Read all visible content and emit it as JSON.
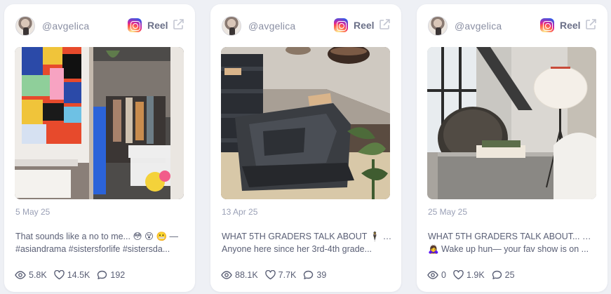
{
  "cards": [
    {
      "username": "@avgelica",
      "type": "Reel",
      "date": "5 May 25",
      "caption_line1": "That sounds like a no to me... 😳 😵 😬 —",
      "caption_line2": "#asiandrama #sistersforlife #sistersda...",
      "views": "5.8K",
      "likes": "14.5K",
      "comments": "192"
    },
    {
      "username": "@avgelica",
      "type": "Reel",
      "date": "13 Apr 25",
      "caption_line1": "WHAT 5TH GRADERS TALK ABOUT 🕴️ ☠️ 🙇‍♀️",
      "caption_line2": "Anyone here since her 3rd-4th grade...",
      "views": "88.1K",
      "likes": "7.7K",
      "comments": "39"
    },
    {
      "username": "@avgelica",
      "type": "Reel",
      "date": "25 May 25",
      "caption_line1": "WHAT 5TH GRADERS TALK ABOUT... 😳 💀",
      "caption_line2": "🙇‍♀️ Wake up hun— your fav show is on ...",
      "views": "0",
      "likes": "1.9K",
      "comments": "25"
    }
  ],
  "icons": {
    "platform": "instagram-icon",
    "external": "external-link-icon",
    "views": "eye-icon",
    "likes": "heart-icon",
    "comments": "comment-icon"
  }
}
